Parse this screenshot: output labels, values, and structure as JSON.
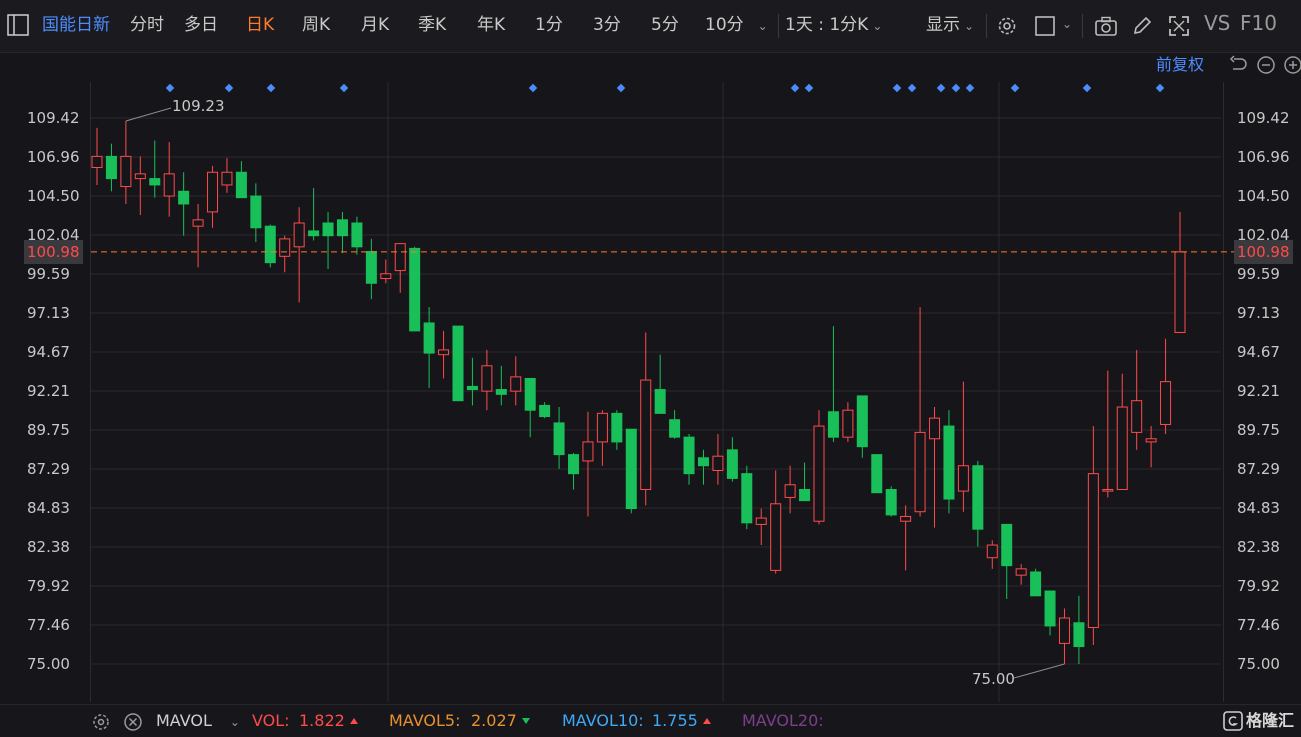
{
  "toolbar": {
    "stock_name": "国能日新",
    "tabs": [
      "分时",
      "多日",
      "日K",
      "周K",
      "月K",
      "季K",
      "年K",
      "1分",
      "3分",
      "5分",
      "10分"
    ],
    "active_tab": "日K",
    "interval_label": "1天 : 1分K",
    "display_label": "显示",
    "vs_label": "VS",
    "f10_label": "F10"
  },
  "adjust_label": "前复权",
  "colors": {
    "up": "#ff4a4a",
    "down": "#19c05a",
    "accent": "#ff7a2f",
    "blue": "#4c8cff",
    "mavol5": "#e8902c",
    "mavol10": "#3fa9f5",
    "mavol20": "#7b3f8c"
  },
  "price_axis": [
    "109.42",
    "106.96",
    "104.50",
    "102.04",
    "99.59",
    "97.13",
    "94.67",
    "92.21",
    "89.75",
    "87.29",
    "84.83",
    "82.38",
    "79.92",
    "77.46",
    "75.00"
  ],
  "current_price": "100.98",
  "annotations": {
    "high": "109.23",
    "low": "75.00"
  },
  "bottom_bar": {
    "indicator": "MAVOL",
    "vol_label": "VOL:",
    "vol_value": "1.822",
    "mavol5_label": "MAVOL5:",
    "mavol5_value": "2.027",
    "mavol10_label": "MAVOL10:",
    "mavol10_value": "1.755",
    "mavol20_label": "MAVOL20:",
    "brand": "格隆汇"
  },
  "chart_data": {
    "type": "candlestick",
    "ylim": [
      75.0,
      109.42
    ],
    "current_price": 100.98,
    "high": 109.23,
    "low": 75.0,
    "candles": [
      {
        "o": 106.3,
        "h": 108.8,
        "l": 105.2,
        "c": 107.0
      },
      {
        "o": 107.0,
        "h": 107.8,
        "l": 104.8,
        "c": 105.6
      },
      {
        "o": 105.1,
        "h": 109.23,
        "l": 104.0,
        "c": 107.0
      },
      {
        "o": 105.6,
        "h": 107.0,
        "l": 103.3,
        "c": 105.9
      },
      {
        "o": 105.6,
        "h": 108.0,
        "l": 104.4,
        "c": 105.2
      },
      {
        "o": 104.5,
        "h": 107.9,
        "l": 103.2,
        "c": 105.9
      },
      {
        "o": 104.8,
        "h": 106.0,
        "l": 102.0,
        "c": 104.0
      },
      {
        "o": 102.6,
        "h": 104.0,
        "l": 100.0,
        "c": 103.0
      },
      {
        "o": 103.5,
        "h": 106.4,
        "l": 102.5,
        "c": 106.0
      },
      {
        "o": 105.2,
        "h": 106.9,
        "l": 104.7,
        "c": 106.0
      },
      {
        "o": 106.0,
        "h": 106.7,
        "l": 104.4,
        "c": 104.4
      },
      {
        "o": 104.5,
        "h": 105.3,
        "l": 101.6,
        "c": 102.5
      },
      {
        "o": 102.6,
        "h": 102.7,
        "l": 100.0,
        "c": 100.3
      },
      {
        "o": 100.7,
        "h": 102.0,
        "l": 99.7,
        "c": 101.8
      },
      {
        "o": 101.3,
        "h": 103.8,
        "l": 97.8,
        "c": 102.8
      },
      {
        "o": 102.3,
        "h": 105.0,
        "l": 101.7,
        "c": 102.0
      },
      {
        "o": 102.8,
        "h": 103.5,
        "l": 99.9,
        "c": 102.0
      },
      {
        "o": 103.0,
        "h": 103.5,
        "l": 100.9,
        "c": 102.0
      },
      {
        "o": 102.8,
        "h": 103.2,
        "l": 100.8,
        "c": 101.3
      },
      {
        "o": 101.0,
        "h": 101.8,
        "l": 98.0,
        "c": 99.0
      },
      {
        "o": 99.3,
        "h": 100.5,
        "l": 99.0,
        "c": 99.6
      },
      {
        "o": 99.8,
        "h": 101.5,
        "l": 98.4,
        "c": 101.5
      },
      {
        "o": 101.2,
        "h": 101.3,
        "l": 96.3,
        "c": 96.0
      },
      {
        "o": 96.5,
        "h": 97.5,
        "l": 92.4,
        "c": 94.6
      },
      {
        "o": 94.5,
        "h": 96.0,
        "l": 93.0,
        "c": 94.8
      },
      {
        "o": 96.3,
        "h": 96.3,
        "l": 91.6,
        "c": 91.6
      },
      {
        "o": 92.5,
        "h": 94.3,
        "l": 91.3,
        "c": 92.3
      },
      {
        "o": 92.2,
        "h": 94.8,
        "l": 91.0,
        "c": 93.8
      },
      {
        "o": 92.3,
        "h": 93.8,
        "l": 91.3,
        "c": 92.0
      },
      {
        "o": 92.2,
        "h": 94.4,
        "l": 91.3,
        "c": 93.1
      },
      {
        "o": 93.0,
        "h": 93.0,
        "l": 89.3,
        "c": 91.0
      },
      {
        "o": 91.3,
        "h": 91.5,
        "l": 90.5,
        "c": 90.6
      },
      {
        "o": 90.2,
        "h": 91.2,
        "l": 87.3,
        "c": 88.2
      },
      {
        "o": 88.2,
        "h": 88.3,
        "l": 86.0,
        "c": 87.0
      },
      {
        "o": 87.8,
        "h": 90.9,
        "l": 84.3,
        "c": 89.0
      },
      {
        "o": 89.0,
        "h": 91.0,
        "l": 87.5,
        "c": 90.8
      },
      {
        "o": 90.8,
        "h": 91.0,
        "l": 88.5,
        "c": 89.0
      },
      {
        "o": 89.8,
        "h": 89.8,
        "l": 84.5,
        "c": 84.8
      },
      {
        "o": 86.0,
        "h": 95.9,
        "l": 85.0,
        "c": 92.9
      },
      {
        "o": 92.3,
        "h": 94.5,
        "l": 91.2,
        "c": 90.8
      },
      {
        "o": 90.4,
        "h": 91.0,
        "l": 89.2,
        "c": 89.3
      },
      {
        "o": 89.3,
        "h": 89.5,
        "l": 86.3,
        "c": 87.0
      },
      {
        "o": 88.0,
        "h": 88.5,
        "l": 86.3,
        "c": 87.5
      },
      {
        "o": 87.2,
        "h": 89.5,
        "l": 86.3,
        "c": 88.1
      },
      {
        "o": 88.5,
        "h": 89.3,
        "l": 86.5,
        "c": 86.7
      },
      {
        "o": 87.0,
        "h": 87.5,
        "l": 83.5,
        "c": 83.9
      },
      {
        "o": 83.8,
        "h": 84.8,
        "l": 82.5,
        "c": 84.2
      },
      {
        "o": 80.9,
        "h": 87.2,
        "l": 80.7,
        "c": 85.1
      },
      {
        "o": 85.5,
        "h": 87.5,
        "l": 84.5,
        "c": 86.3
      },
      {
        "o": 86.0,
        "h": 87.7,
        "l": 85.4,
        "c": 85.3
      },
      {
        "o": 84.0,
        "h": 91.0,
        "l": 83.8,
        "c": 90.0
      },
      {
        "o": 90.9,
        "h": 96.3,
        "l": 89.0,
        "c": 89.3
      },
      {
        "o": 89.3,
        "h": 91.5,
        "l": 89.0,
        "c": 91.0
      },
      {
        "o": 91.9,
        "h": 91.9,
        "l": 88.0,
        "c": 88.7
      },
      {
        "o": 88.2,
        "h": 88.2,
        "l": 86.0,
        "c": 85.8
      },
      {
        "o": 86.0,
        "h": 86.2,
        "l": 84.3,
        "c": 84.4
      },
      {
        "o": 84.0,
        "h": 85.0,
        "l": 80.9,
        "c": 84.3
      },
      {
        "o": 84.6,
        "h": 97.5,
        "l": 84.3,
        "c": 89.6
      },
      {
        "o": 89.2,
        "h": 91.2,
        "l": 83.6,
        "c": 90.5
      },
      {
        "o": 90.0,
        "h": 91.0,
        "l": 84.5,
        "c": 85.4
      },
      {
        "o": 85.9,
        "h": 92.8,
        "l": 84.6,
        "c": 87.5
      },
      {
        "o": 87.5,
        "h": 87.8,
        "l": 82.4,
        "c": 83.5
      },
      {
        "o": 81.7,
        "h": 82.8,
        "l": 81.0,
        "c": 82.5
      },
      {
        "o": 83.8,
        "h": 83.8,
        "l": 79.1,
        "c": 81.2
      },
      {
        "o": 80.6,
        "h": 81.3,
        "l": 80.0,
        "c": 81.0
      },
      {
        "o": 80.8,
        "h": 81.0,
        "l": 79.3,
        "c": 79.3
      },
      {
        "o": 79.6,
        "h": 79.6,
        "l": 76.8,
        "c": 77.4
      },
      {
        "o": 76.3,
        "h": 78.5,
        "l": 75.0,
        "c": 77.9
      },
      {
        "o": 77.6,
        "h": 79.3,
        "l": 75.0,
        "c": 76.1
      },
      {
        "o": 77.3,
        "h": 90.0,
        "l": 76.2,
        "c": 87.0
      },
      {
        "o": 85.9,
        "h": 93.5,
        "l": 85.5,
        "c": 86.0
      },
      {
        "o": 86.0,
        "h": 93.3,
        "l": 86.0,
        "c": 91.2
      },
      {
        "o": 89.6,
        "h": 94.8,
        "l": 88.5,
        "c": 91.6
      },
      {
        "o": 89.0,
        "h": 90.0,
        "l": 87.4,
        "c": 89.2
      },
      {
        "o": 90.1,
        "h": 95.5,
        "l": 89.5,
        "c": 92.8
      },
      {
        "o": 95.9,
        "h": 103.5,
        "l": 95.9,
        "c": 100.98
      }
    ]
  }
}
